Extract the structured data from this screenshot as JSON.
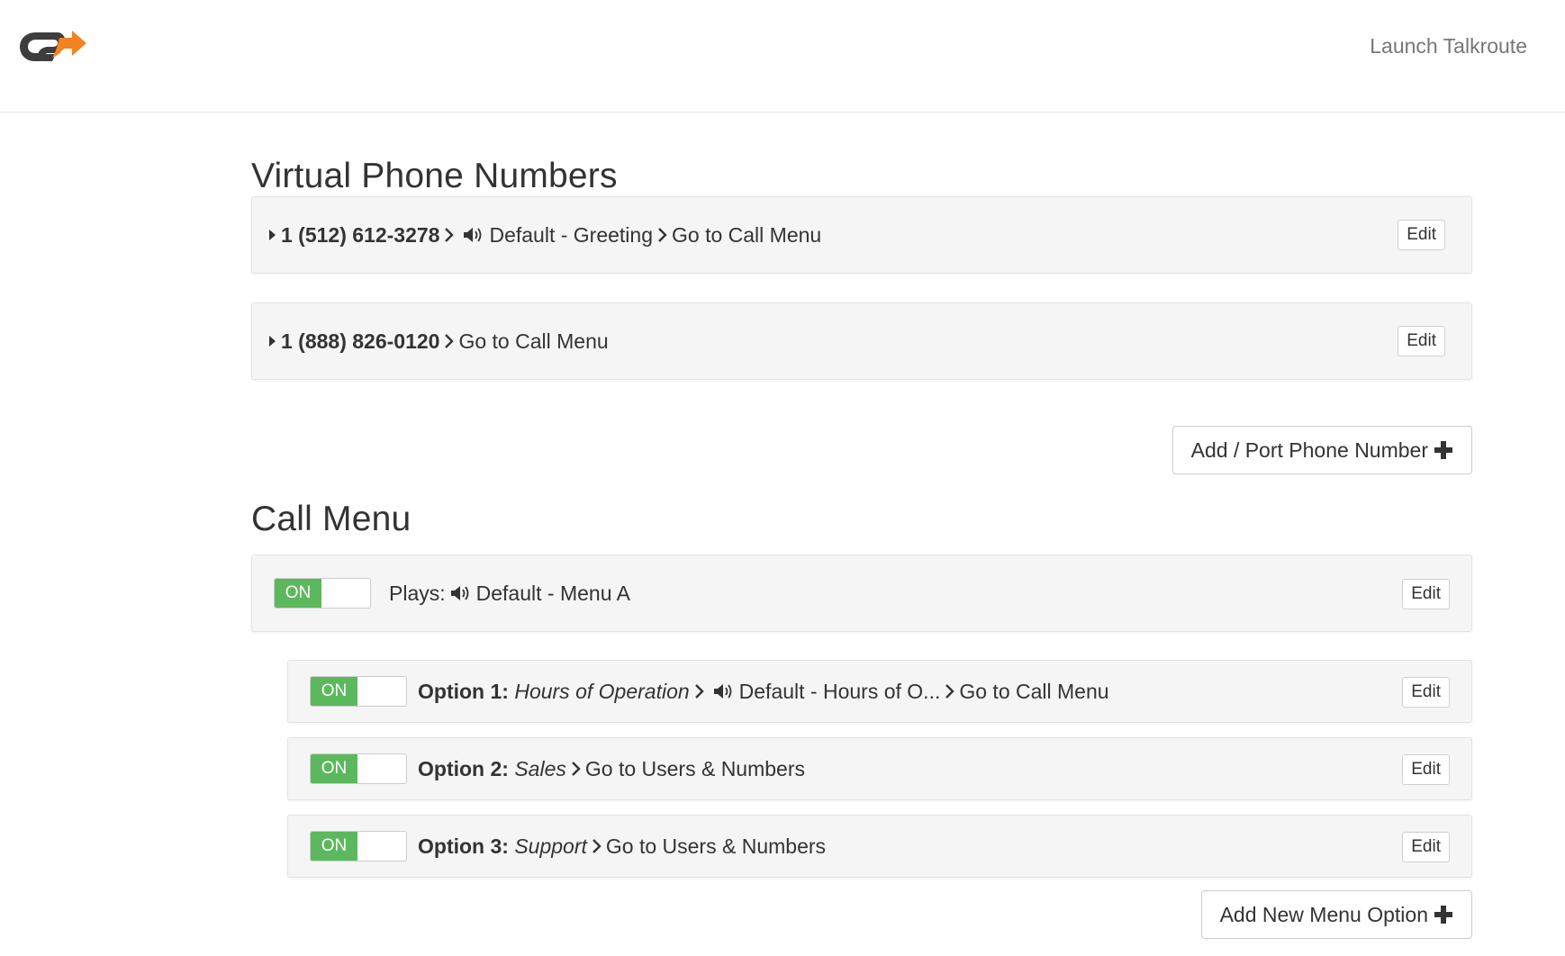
{
  "header": {
    "logo_name": "talkroute-logo",
    "launch_label": "Launch Talkroute"
  },
  "vpn": {
    "title": "Virtual Phone Numbers",
    "numbers": [
      {
        "number": "1 (512) 612-3278",
        "greeting": "Default - Greeting",
        "action": "Go to Call Menu",
        "edit_label": "Edit"
      },
      {
        "number": "1 (888) 826-0120",
        "action": "Go to Call Menu",
        "edit_label": "Edit"
      }
    ],
    "add_button_label": "Add / Port Phone Number"
  },
  "call_menu": {
    "title": "Call Menu",
    "main": {
      "toggle_label": "ON",
      "plays_label": "Plays:",
      "recording": "Default - Menu A",
      "edit_label": "Edit"
    },
    "options": [
      {
        "toggle_label": "ON",
        "label": "Option 1:",
        "name": "Hours of Operation",
        "recording": "Default - Hours of O...",
        "action": "Go to Call Menu",
        "edit_label": "Edit"
      },
      {
        "toggle_label": "ON",
        "label": "Option 2:",
        "name": "Sales",
        "action": "Go to Users & Numbers",
        "edit_label": "Edit"
      },
      {
        "toggle_label": "ON",
        "label": "Option 3:",
        "name": "Support",
        "action": "Go to Users & Numbers",
        "edit_label": "Edit"
      }
    ],
    "add_button_label": "Add New Menu Option"
  },
  "colors": {
    "toggle_on": "#5cb85c",
    "logo_dark": "#3d3d3d",
    "logo_accent": "#f58220",
    "panel_bg": "#f5f5f5"
  }
}
